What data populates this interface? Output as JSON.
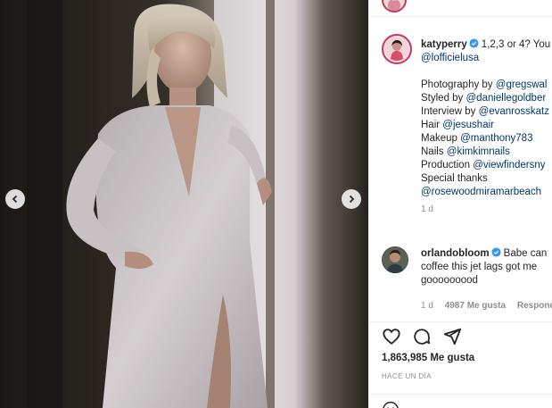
{
  "post": {
    "nav_prev_icon": "chevron-left-icon",
    "nav_next_icon": "chevron-right-icon"
  },
  "caption": {
    "username": "katyperry",
    "first_line": "1,2,3 or 4? You",
    "lines": [
      "@lofficielusa",
      "",
      "Photography by @gregswal",
      "Styled by @daniellegoldber",
      "Interview by @evanrosskatz",
      "Hair @jesushair",
      "Makeup @manthony783",
      "Nails @kimkimnails",
      "Production @viewfindersny",
      "Special thanks",
      "@rosewoodmiramarbeach"
    ],
    "time": "1 d"
  },
  "comment": {
    "username": "orlandobloom",
    "first_line": "Babe can",
    "line2": "coffee this jet lags got me",
    "line3": "gooooooood",
    "time": "1 d",
    "likes": "4987 Me gusta",
    "reply": "Respond"
  },
  "actions": {
    "like_icon": "heart-icon",
    "comment_icon": "comment-icon",
    "share_icon": "share-icon"
  },
  "likes": "1,863,985 Me gusta",
  "posted": "HACE UN DÍA",
  "colors": {
    "link": "#00376b",
    "verified": "#3897f0",
    "muted": "#8e8e8e"
  }
}
